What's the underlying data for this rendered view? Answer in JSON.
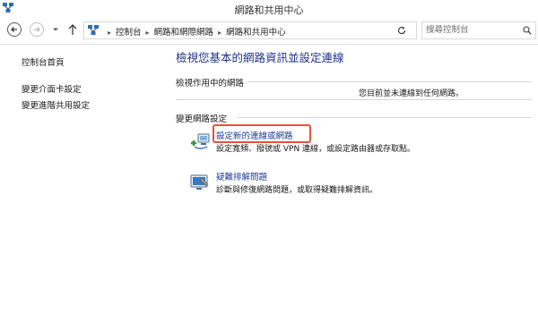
{
  "window": {
    "title": "網路和共用中心",
    "app_icon": "network-center-icon"
  },
  "address_bar": {
    "back_icon": "back-arrow-icon",
    "forward_icon": "forward-arrow-icon",
    "recent_icon": "chevron-down-icon",
    "up_icon": "up-arrow-icon",
    "location_icon": "network-center-icon",
    "breadcrumbs": [
      "控制台",
      "網路和網際網路",
      "網路和共用中心"
    ],
    "refresh_icon": "refresh-icon",
    "search_placeholder": "搜尋控制台",
    "search_icon": "search-icon"
  },
  "sidebar": {
    "items": [
      {
        "label": "控制台首頁"
      },
      {
        "label": "變更介面卡設定"
      },
      {
        "label": "變更進階共用設定"
      }
    ]
  },
  "main": {
    "title": "檢視您基本的網路資訊並設定連線",
    "active_networks_label": "檢視作用中的網路",
    "connection_status": "您目前並未連線到任何網路。",
    "change_settings_label": "變更網路設定",
    "tasks": [
      {
        "link": "設定新的連線或網路",
        "desc": "設定寬頻、撥號或 VPN 連線，或設定路由器或存取點。",
        "icon": "new-connection-icon"
      },
      {
        "link": "疑難排解問題",
        "desc": "診斷與修復網路問題，或取得疑難排解資訊。",
        "icon": "troubleshoot-icon"
      }
    ]
  },
  "colors": {
    "link": "#1e3c96",
    "title": "#1e3287",
    "highlight_box": "#e0553a"
  }
}
